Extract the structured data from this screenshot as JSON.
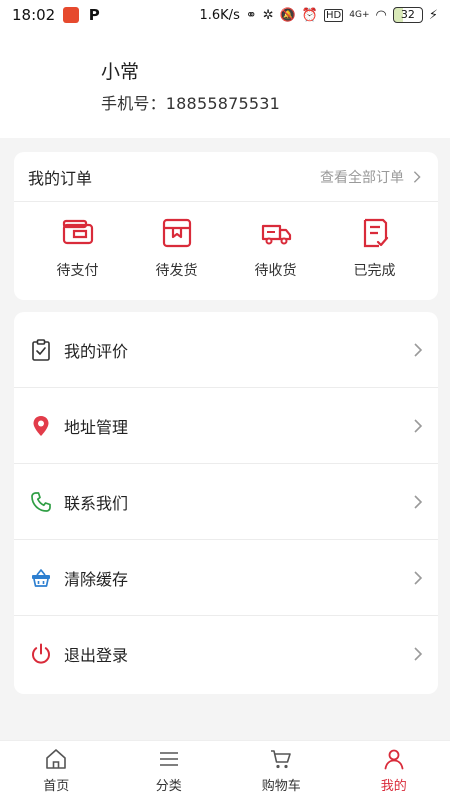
{
  "status_bar": {
    "time": "18:02",
    "app_p": "P",
    "net_speed": "1.6K/s",
    "hd": "HD",
    "signal": "4G+",
    "battery": "32"
  },
  "profile": {
    "name": "小常",
    "phone_label": "手机号：18855875531"
  },
  "orders": {
    "title": "我的订单",
    "view_all": "查看全部订单",
    "items": [
      {
        "label": "待支付",
        "icon": "wallet-icon"
      },
      {
        "label": "待发货",
        "icon": "package-icon"
      },
      {
        "label": "待收货",
        "icon": "truck-icon"
      },
      {
        "label": "已完成",
        "icon": "document-check-icon"
      }
    ]
  },
  "menu": {
    "items": [
      {
        "label": "我的评价",
        "icon": "clipboard-check-icon"
      },
      {
        "label": "地址管理",
        "icon": "location-pin-icon"
      },
      {
        "label": "联系我们",
        "icon": "phone-icon"
      },
      {
        "label": "清除缓存",
        "icon": "basket-icon"
      },
      {
        "label": "退出登录",
        "icon": "power-icon"
      }
    ]
  },
  "tabs": [
    {
      "label": "首页",
      "icon": "home-icon"
    },
    {
      "label": "分类",
      "icon": "list-icon"
    },
    {
      "label": "购物车",
      "icon": "cart-icon"
    },
    {
      "label": "我的",
      "icon": "user-icon",
      "active": true
    }
  ],
  "colors": {
    "accent": "#d92b3a",
    "phone_green": "#2f9e44",
    "basket_blue": "#2d7fd0"
  }
}
